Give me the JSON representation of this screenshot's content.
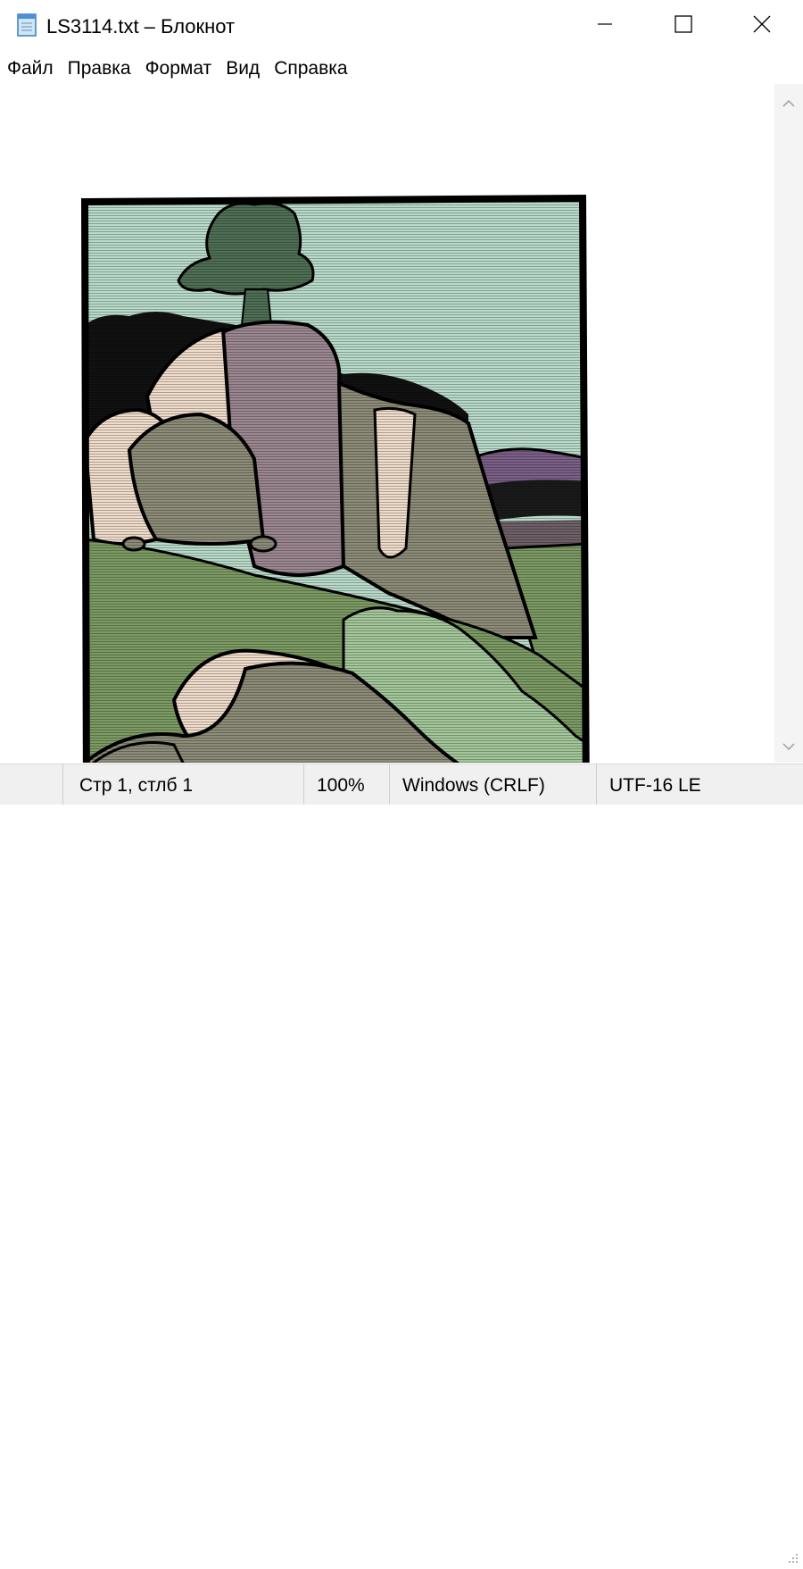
{
  "window": {
    "title": "LS3114.txt – Блокнот",
    "controls": {
      "minimize_icon": "minimize-icon",
      "maximize_icon": "maximize-icon",
      "close_icon": "close-icon"
    }
  },
  "menu": {
    "items": [
      {
        "label": "Файл"
      },
      {
        "label": "Правка"
      },
      {
        "label": "Формат"
      },
      {
        "label": "Вид"
      },
      {
        "label": "Справка"
      }
    ]
  },
  "editor": {
    "content": "ASCII-art landscape: rocky cliffs, pine tree, hills and bushes",
    "colors": {
      "sky": "#b9dbca",
      "tree": "#4f6f55",
      "cliff_purple": "#9b8790",
      "rock_light": "#f0dccb",
      "rock_gray": "#8d8c78",
      "hill_purple": "#7a5f86",
      "grass": "#7c9a63",
      "bush": "#a3c79a",
      "outline": "#000000"
    }
  },
  "status": {
    "position": "Стр 1, стлб 1",
    "zoom": "100%",
    "line_endings": "Windows (CRLF)",
    "encoding": "UTF-16 LE"
  }
}
